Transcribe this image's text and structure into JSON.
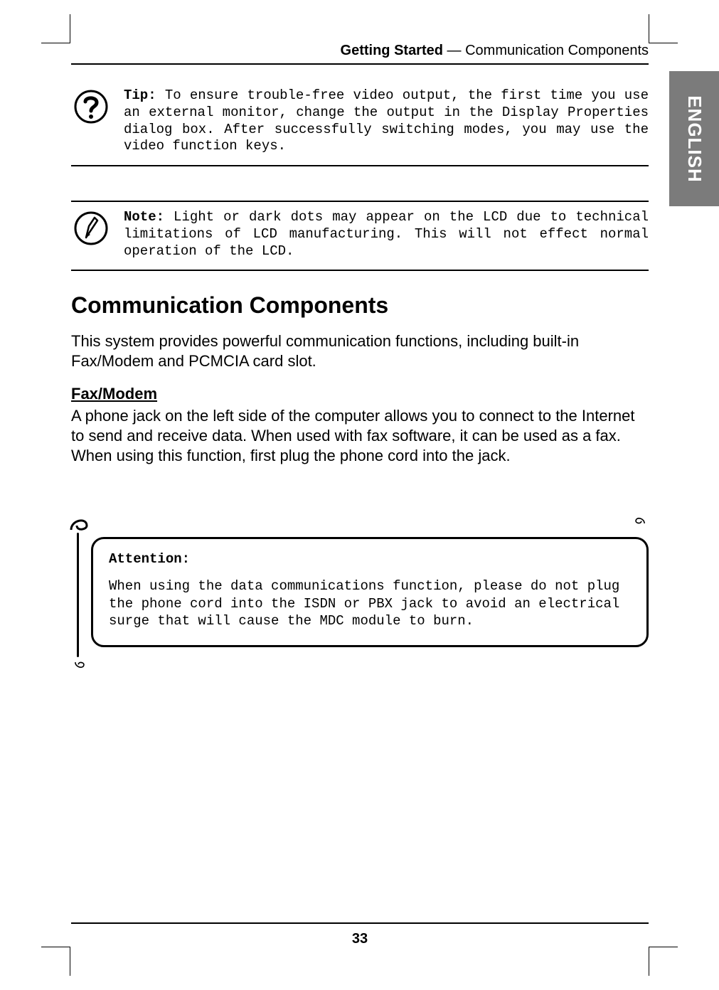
{
  "header": {
    "section": "Getting Started",
    "separator": " — ",
    "topic": "Communication Components"
  },
  "sideTab": "ENGLISH",
  "tip": {
    "label": "Tip:",
    "text": " To ensure trouble-free video output, the first time you use an external monitor, change the output in the Display Properties dialog box. After successfully switching modes, you may use the video function keys."
  },
  "note": {
    "label": "Note:",
    "text": " Light or dark dots may appear on the LCD due to technical limitations of LCD manufacturing. This will not effect normal operation of the LCD."
  },
  "sectionTitle": "Communication Components",
  "intro": "This system provides powerful communication functions, including built-in Fax/Modem and PCMCIA card slot.",
  "subHeading": "Fax/Modem",
  "subBody": "A phone jack on the left side of the computer allows you to connect to the Internet to send and receive data. When used with fax software, it can be used as a fax. When using this function, first plug the phone cord into the jack.",
  "attention": {
    "label": "Attention:",
    "text": "When using the data communications function, please do not plug the phone cord into the ISDN or PBX jack to avoid an electrical surge that will cause the MDC module to burn."
  },
  "pageNumber": "33",
  "icons": {
    "tip": "question-mark-circle-icon",
    "note": "pen-circle-icon",
    "spiral": "spiral-binding-icon"
  }
}
